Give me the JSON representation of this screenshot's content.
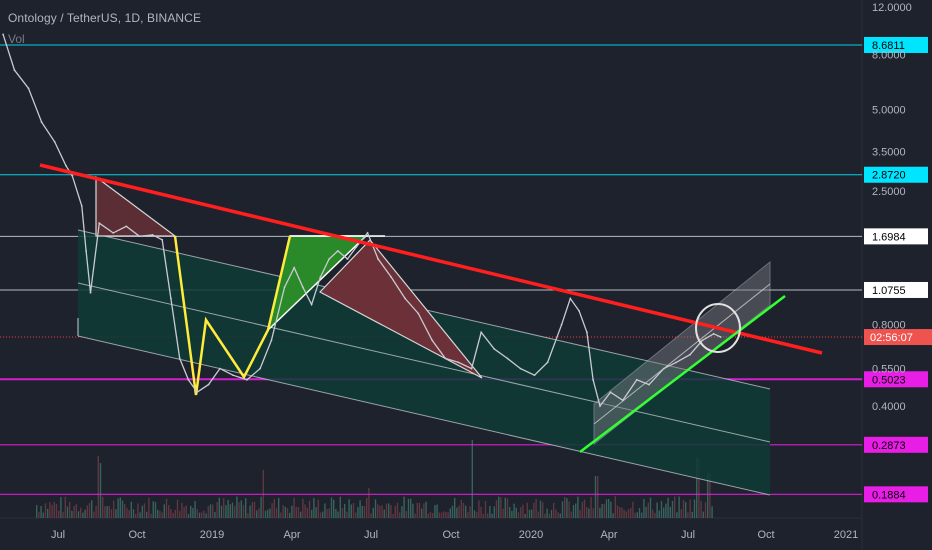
{
  "header": {
    "title": "Ontology / TetherUS, 1D, BINANCE",
    "volume_label": "Vol"
  },
  "colors": {
    "background": "#1e222d",
    "axis_text": "#b2b5be",
    "resistance_line": "#ff1f1f",
    "support_line": "#33ff33",
    "zigzag": "#ffeb3b",
    "channel_fill": "#0f3b37",
    "candle": "#c8cbd0",
    "cyan_level": "#00e5ff",
    "magenta_level": "#e91ee6",
    "current_price": "#ff3b3b"
  },
  "chart_data": {
    "type": "line",
    "title": "Ontology / TetherUS, 1D, BINANCE",
    "log_scale": true,
    "price_axis": {
      "ticks": [
        "12.0000",
        "8.0000",
        "5.0000",
        "3.5000",
        "2.5000",
        "0.8000",
        "0.5500",
        "0.4000"
      ],
      "tick_values": [
        12.0,
        8.0,
        5.0,
        3.5,
        2.5,
        0.8,
        0.55,
        0.4
      ]
    },
    "time_axis": {
      "ticks": [
        "Jul",
        "Oct",
        "2019",
        "Apr",
        "Jul",
        "Oct",
        "2020",
        "Apr",
        "Jul",
        "Oct",
        "2021"
      ]
    },
    "horizontal_levels": [
      {
        "value": 8.6811,
        "label": "8.6811",
        "style": "cyan"
      },
      {
        "value": 2.872,
        "label": "2.8720",
        "style": "cyan"
      },
      {
        "value": 1.6984,
        "label": "1.6984",
        "style": "white"
      },
      {
        "value": 1.0755,
        "label": "1.0755",
        "style": "white"
      },
      {
        "value": 0.5023,
        "label": "0.5023",
        "style": "magenta"
      },
      {
        "value": 0.2873,
        "label": "0.2873",
        "style": "magenta"
      },
      {
        "value": 0.1884,
        "label": "0.1884",
        "style": "magenta"
      }
    ],
    "current_price": {
      "value": 0.72,
      "countdown": "02:56:07"
    },
    "series": [
      {
        "values": [
          [
            "2018-05-07",
            9.5
          ],
          [
            "2018-05-20",
            7.0
          ],
          [
            "2018-06-05",
            6.0
          ],
          [
            "2018-06-20",
            4.5
          ],
          [
            "2018-07-05",
            3.8
          ],
          [
            "2018-07-18",
            3.1
          ],
          [
            "2018-07-25",
            2.85
          ],
          [
            "2018-08-05",
            2.2
          ],
          [
            "2018-08-10",
            1.5
          ],
          [
            "2018-08-15",
            1.05
          ],
          [
            "2018-08-25",
            1.9
          ],
          [
            "2018-09-10",
            1.75
          ],
          [
            "2018-09-25",
            1.85
          ],
          [
            "2018-10-10",
            1.7
          ],
          [
            "2018-10-25",
            1.72
          ],
          [
            "2018-11-05",
            1.65
          ],
          [
            "2018-11-15",
            1.0
          ],
          [
            "2018-11-25",
            0.6
          ],
          [
            "2018-12-05",
            0.5
          ],
          [
            "2018-12-15",
            0.45
          ],
          [
            "2018-12-28",
            0.48
          ],
          [
            "2019-01-10",
            0.55
          ],
          [
            "2019-01-25",
            0.52
          ],
          [
            "2019-02-10",
            0.5
          ],
          [
            "2019-02-25",
            0.55
          ],
          [
            "2019-03-10",
            0.7
          ],
          [
            "2019-03-25",
            1.1
          ],
          [
            "2019-04-05",
            1.3
          ],
          [
            "2019-04-15",
            1.1
          ],
          [
            "2019-04-25",
            0.95
          ],
          [
            "2019-05-05",
            1.2
          ],
          [
            "2019-05-15",
            1.4
          ],
          [
            "2019-05-25",
            1.5
          ],
          [
            "2019-06-05",
            1.4
          ],
          [
            "2019-06-15",
            1.55
          ],
          [
            "2019-06-28",
            1.75
          ],
          [
            "2019-07-10",
            1.4
          ],
          [
            "2019-07-25",
            1.2
          ],
          [
            "2019-08-10",
            1.0
          ],
          [
            "2019-08-25",
            0.88
          ],
          [
            "2019-09-10",
            0.7
          ],
          [
            "2019-09-25",
            0.6
          ],
          [
            "2019-10-10",
            0.58
          ],
          [
            "2019-10-25",
            0.55
          ],
          [
            "2019-11-05",
            0.75
          ],
          [
            "2019-11-20",
            0.65
          ],
          [
            "2019-12-05",
            0.6
          ],
          [
            "2019-12-20",
            0.55
          ],
          [
            "2020-01-05",
            0.52
          ],
          [
            "2020-01-20",
            0.58
          ],
          [
            "2020-02-05",
            0.8
          ],
          [
            "2020-02-15",
            1.0
          ],
          [
            "2020-02-25",
            0.9
          ],
          [
            "2020-03-05",
            0.75
          ],
          [
            "2020-03-12",
            0.5
          ],
          [
            "2020-03-20",
            0.4
          ],
          [
            "2020-04-01",
            0.45
          ],
          [
            "2020-04-15",
            0.42
          ],
          [
            "2020-05-01",
            0.5
          ],
          [
            "2020-05-15",
            0.48
          ],
          [
            "2020-06-01",
            0.55
          ],
          [
            "2020-06-15",
            0.58
          ],
          [
            "2020-07-01",
            0.62
          ],
          [
            "2020-07-15",
            0.7
          ],
          [
            "2020-07-28",
            0.74
          ],
          [
            "2020-08-05",
            0.72
          ]
        ]
      }
    ]
  }
}
